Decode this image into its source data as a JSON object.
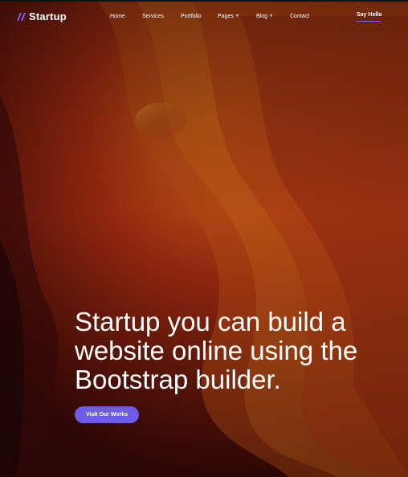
{
  "brand": {
    "name": "Startup"
  },
  "nav": {
    "items": [
      {
        "label": "Home",
        "dropdown": false
      },
      {
        "label": "Services",
        "dropdown": false
      },
      {
        "label": "Portfolio",
        "dropdown": false
      },
      {
        "label": "Pages",
        "dropdown": true
      },
      {
        "label": "Blog",
        "dropdown": true
      },
      {
        "label": "Contact",
        "dropdown": false
      }
    ],
    "cta_label": "Say Hello"
  },
  "hero": {
    "headline": "Startup you can build a website online using the Bootstrap builder.",
    "button_label": "Visit Our Works"
  },
  "colors": {
    "accent": "#6c5ce7",
    "underline": "#7b61ff",
    "bg_dark": "#2a0a08",
    "bg_warm": "#c4561a"
  }
}
